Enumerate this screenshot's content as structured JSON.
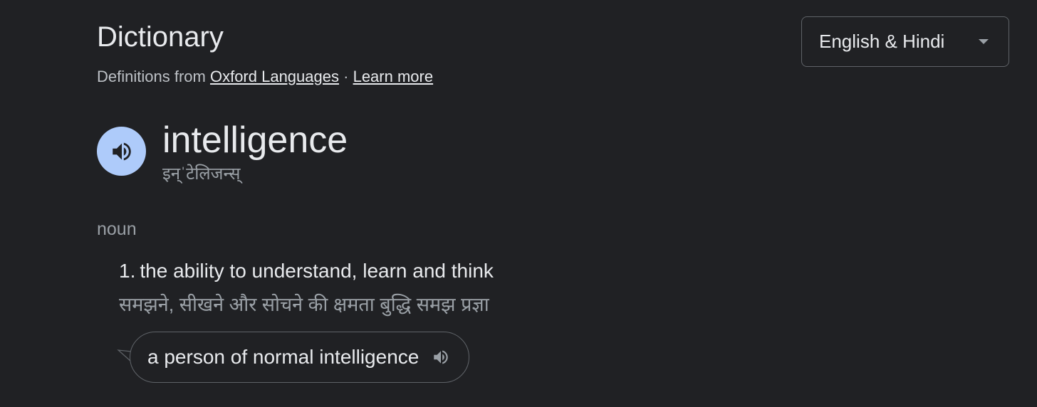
{
  "header": {
    "title": "Dictionary",
    "source_prefix": "Definitions from",
    "source_link": "Oxford Languages",
    "separator": "·",
    "learn_more": "Learn more"
  },
  "language_select": {
    "selected": "English & Hindi",
    "caret_icon": "chevron-down-icon"
  },
  "entry": {
    "word": "intelligence",
    "phonetic": "इन्ˈटेलिजन्स्",
    "speaker_icon": "speaker-icon",
    "speaker_color": "#aecbfa",
    "part_of_speech": "noun",
    "senses": [
      {
        "number": "1.",
        "definition": "the ability to understand, learn and think",
        "translation": "समझने, सीखने और सोचने की क्षमता बुद्धि समझ प्रज्ञा",
        "example": "a person of normal intelligence"
      }
    ]
  },
  "colors": {
    "background": "#202124",
    "text_primary": "#e8eaed",
    "text_secondary": "#9aa0a6",
    "border": "#5f6368"
  }
}
